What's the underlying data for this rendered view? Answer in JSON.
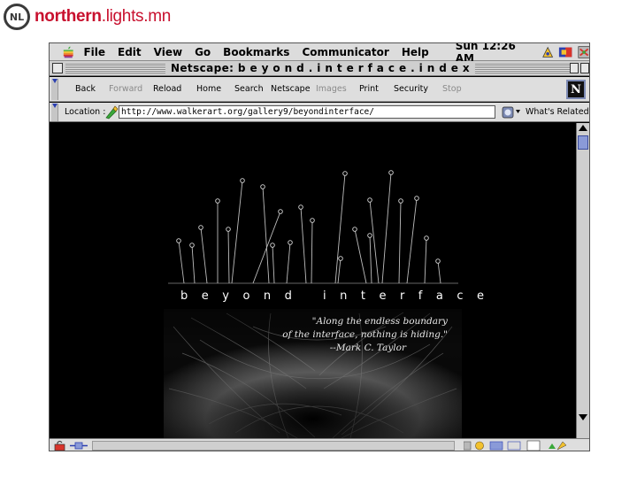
{
  "brand": {
    "logo_text": "NL",
    "name_bold": "northern",
    "name_rest": ".lights.mn"
  },
  "menubar": {
    "items": [
      "File",
      "Edit",
      "View",
      "Go",
      "Bookmarks",
      "Communicator",
      "Help"
    ],
    "clock": "Sun 12:26 AM"
  },
  "window": {
    "title": "Netscape: b e y o n d . i n t e r f a c e . i n d e x"
  },
  "toolbar": {
    "back": "Back",
    "forward": "Forward",
    "reload": "Reload",
    "home": "Home",
    "search": "Search",
    "netscape": "Netscape",
    "images": "Images",
    "print": "Print",
    "security": "Security",
    "stop": "Stop",
    "logo": "N"
  },
  "location": {
    "label": "Location :",
    "url": "http://www.walkerart.org/gallery9/beyondinterface/",
    "related_label": "What's Related"
  },
  "page": {
    "title": "beyond interface",
    "quote_line1": "\"Along the endless boundary",
    "quote_line2": "of the interface, nothing is hiding.\"",
    "quote_attribution": "--Mark C. Taylor"
  },
  "colors": {
    "brand_red": "#c8102e",
    "page_background": "#000000",
    "chrome_gray": "#dedede",
    "scroll_thumb": "#8a9ad8"
  }
}
